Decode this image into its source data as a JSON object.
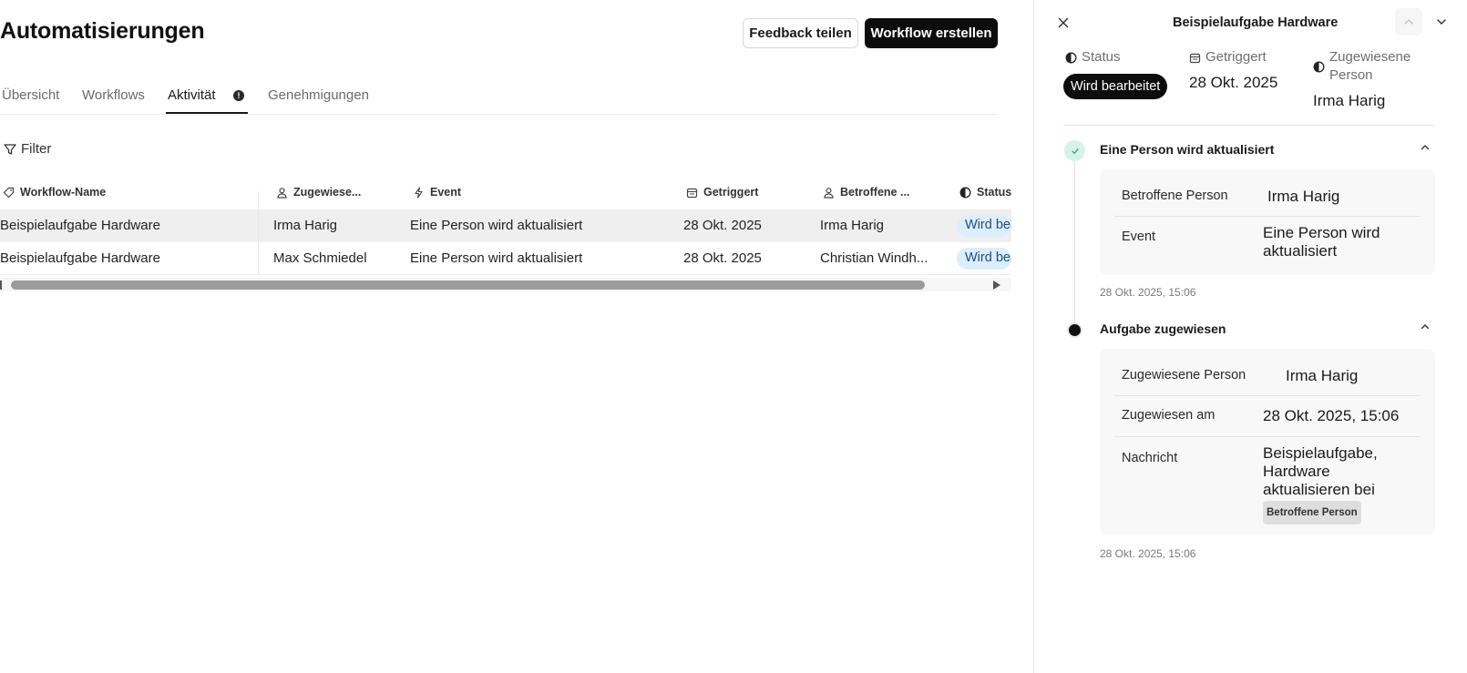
{
  "header": {
    "title": "Automatisierungen",
    "feedback_button": "Feedback teilen",
    "create_button": "Workflow erstellen"
  },
  "tabs": [
    {
      "label": "Übersicht",
      "active": false
    },
    {
      "label": "Workflows",
      "active": false
    },
    {
      "label": "Aktivität",
      "active": true
    },
    {
      "label": "Genehmigungen",
      "active": false
    }
  ],
  "filter": {
    "label": "Filter"
  },
  "table": {
    "columns": [
      {
        "label": "Workflow-Name",
        "icon": "tag-icon"
      },
      {
        "label": "Zugewiese...",
        "icon": "person-icon"
      },
      {
        "label": "Event",
        "icon": "bolt-icon"
      },
      {
        "label": "Getriggert",
        "icon": "calendar-icon"
      },
      {
        "label": "Betroffene ...",
        "icon": "person-icon"
      },
      {
        "label": "Status",
        "icon": "half-circle-icon"
      }
    ],
    "rows": [
      {
        "workflow": "Beispielaufgabe Hardware",
        "assignee": "Irma Harig",
        "event": "Eine Person wird aktualisiert",
        "triggered": "28 Okt. 2025",
        "affected": "Irma Harig",
        "status": "Wird bearbeitet",
        "selected": true
      },
      {
        "workflow": "Beispielaufgabe Hardware",
        "assignee": "Max Schmiedel",
        "event": "Eine Person wird aktualisiert",
        "triggered": "28 Okt. 2025",
        "affected": "Christian Windh...",
        "status": "Wird bearbeitet",
        "selected": false
      }
    ]
  },
  "panel": {
    "title": "Beispielaufgabe Hardware",
    "meta": {
      "status_label": "Status",
      "status_value": "Wird bearbeitet",
      "triggered_label": "Getriggert",
      "triggered_value": "28 Okt. 2025",
      "assignee_label_1": "Zugewiesene",
      "assignee_label_2": "Person",
      "assignee_value": "Irma Harig"
    },
    "sections": [
      {
        "title": "Eine Person wird aktualisiert",
        "fields": [
          {
            "key": "Betroffene Person",
            "value": "Irma Harig"
          },
          {
            "key": "Event",
            "value": "Eine Person wird aktualisiert"
          }
        ],
        "timestamp": "28 Okt. 2025, 15:06"
      },
      {
        "title": "Aufgabe zugewiesen",
        "fields": [
          {
            "key": "Zugewiesene Person",
            "value": "Irma Harig"
          },
          {
            "key": "Zugewiesen am",
            "value": "28 Okt. 2025, 15:06"
          },
          {
            "key": "Nachricht",
            "value": "Beispielaufgabe, Hardware aktualisieren bei",
            "tag": "Betroffene Person"
          }
        ],
        "timestamp": "28 Okt. 2025, 15:06"
      }
    ]
  },
  "colors": {
    "primary": "#0d0d0d",
    "status_pill_bg": "#dceefb",
    "status_pill_text": "#1f4d7a",
    "success_dot": "#d7f3e9",
    "selected_row": "#efefef"
  }
}
